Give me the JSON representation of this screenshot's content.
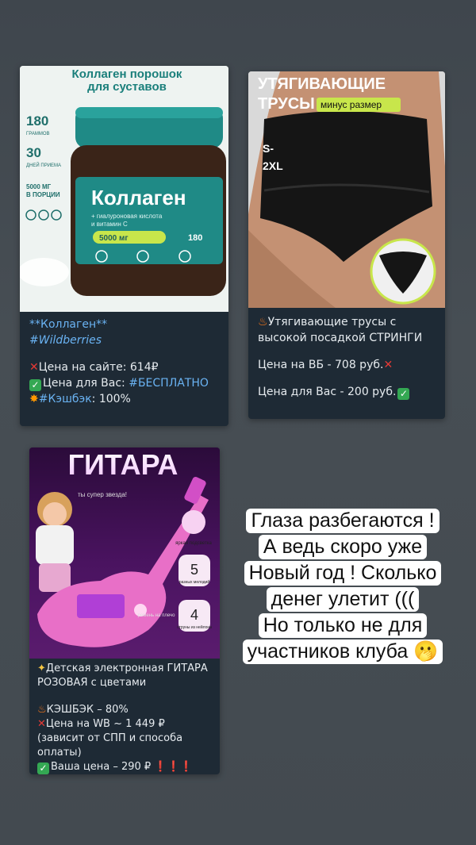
{
  "card1": {
    "image": {
      "banner": "Коллаген порошок для суставов",
      "badges": [
        {
          "num": "180",
          "unit": "ГРАММОВ"
        },
        {
          "num": "30",
          "unit": "ДНЕЙ ПРИЕМА"
        },
        {
          "num": "5000 МГ",
          "unit": "В ПОРЦИИ"
        }
      ],
      "jar_title": "Коллаген",
      "jar_sub": "+ гиалуроновая кислота и витамин С",
      "jar_dose": "5000 мг",
      "jar_count": "180"
    },
    "caption": {
      "title": "**Коллаген**",
      "tag": "#Wildberries",
      "price_site_label": "Цена на сайте: 614₽",
      "price_you_label": "Цена для Вас: ",
      "price_you_value": "#БЕСПЛАТНО",
      "cashback_tag": "#Кэшбэк",
      "cashback_value": ": 100%"
    }
  },
  "card2": {
    "image": {
      "title_line1": "УТЯГИВАЮЩИЕ",
      "title_line2": "ТРУСЫ",
      "badge": "минус размер",
      "size_1": "S-",
      "size_2": "2XL"
    },
    "caption": {
      "title_line1": "Утягивающие трусы с",
      "title_line2": "высокой посадкой СТРИНГИ",
      "price_wb": "Цена на ВБ - 708 руб.",
      "price_you": "Цена для Вас - 200 руб."
    }
  },
  "card3": {
    "image": {
      "title": "ГИТАРА",
      "star_text": "ты супер звезда!",
      "feat1": "яркая подсветка",
      "feat2_num": "5",
      "feat2": "разных мелодий",
      "feat3_num": "4",
      "feat3": "струны из нейлона",
      "strap": "ремень на плечо"
    },
    "caption": {
      "title_line1": "Детская электронная ГИТАРА",
      "title_line2": "РОЗОВАЯ с цветами",
      "cashback": "КЭШБЭК – 80%",
      "price_wb": "Цена на WB ~ 1 449 ₽",
      "note_line1": "(зависит от СПП и способа",
      "note_line2": "оплаты)",
      "price_you": "Ваша цена – 290 ₽",
      "marks": "❗❗❗"
    }
  },
  "overlay": {
    "lines": [
      "Глаза разбегаются !",
      "А ведь скоро уже",
      "Новый год ! Сколько",
      "денег улетит (((",
      "Но только не для",
      "участников клуба 🫢"
    ]
  },
  "colors": {
    "background": "#444b51",
    "card_bg": "#1e2a35",
    "link": "#6ab3f3",
    "teal": "#1f8a86",
    "purple": "#b03fd6"
  }
}
